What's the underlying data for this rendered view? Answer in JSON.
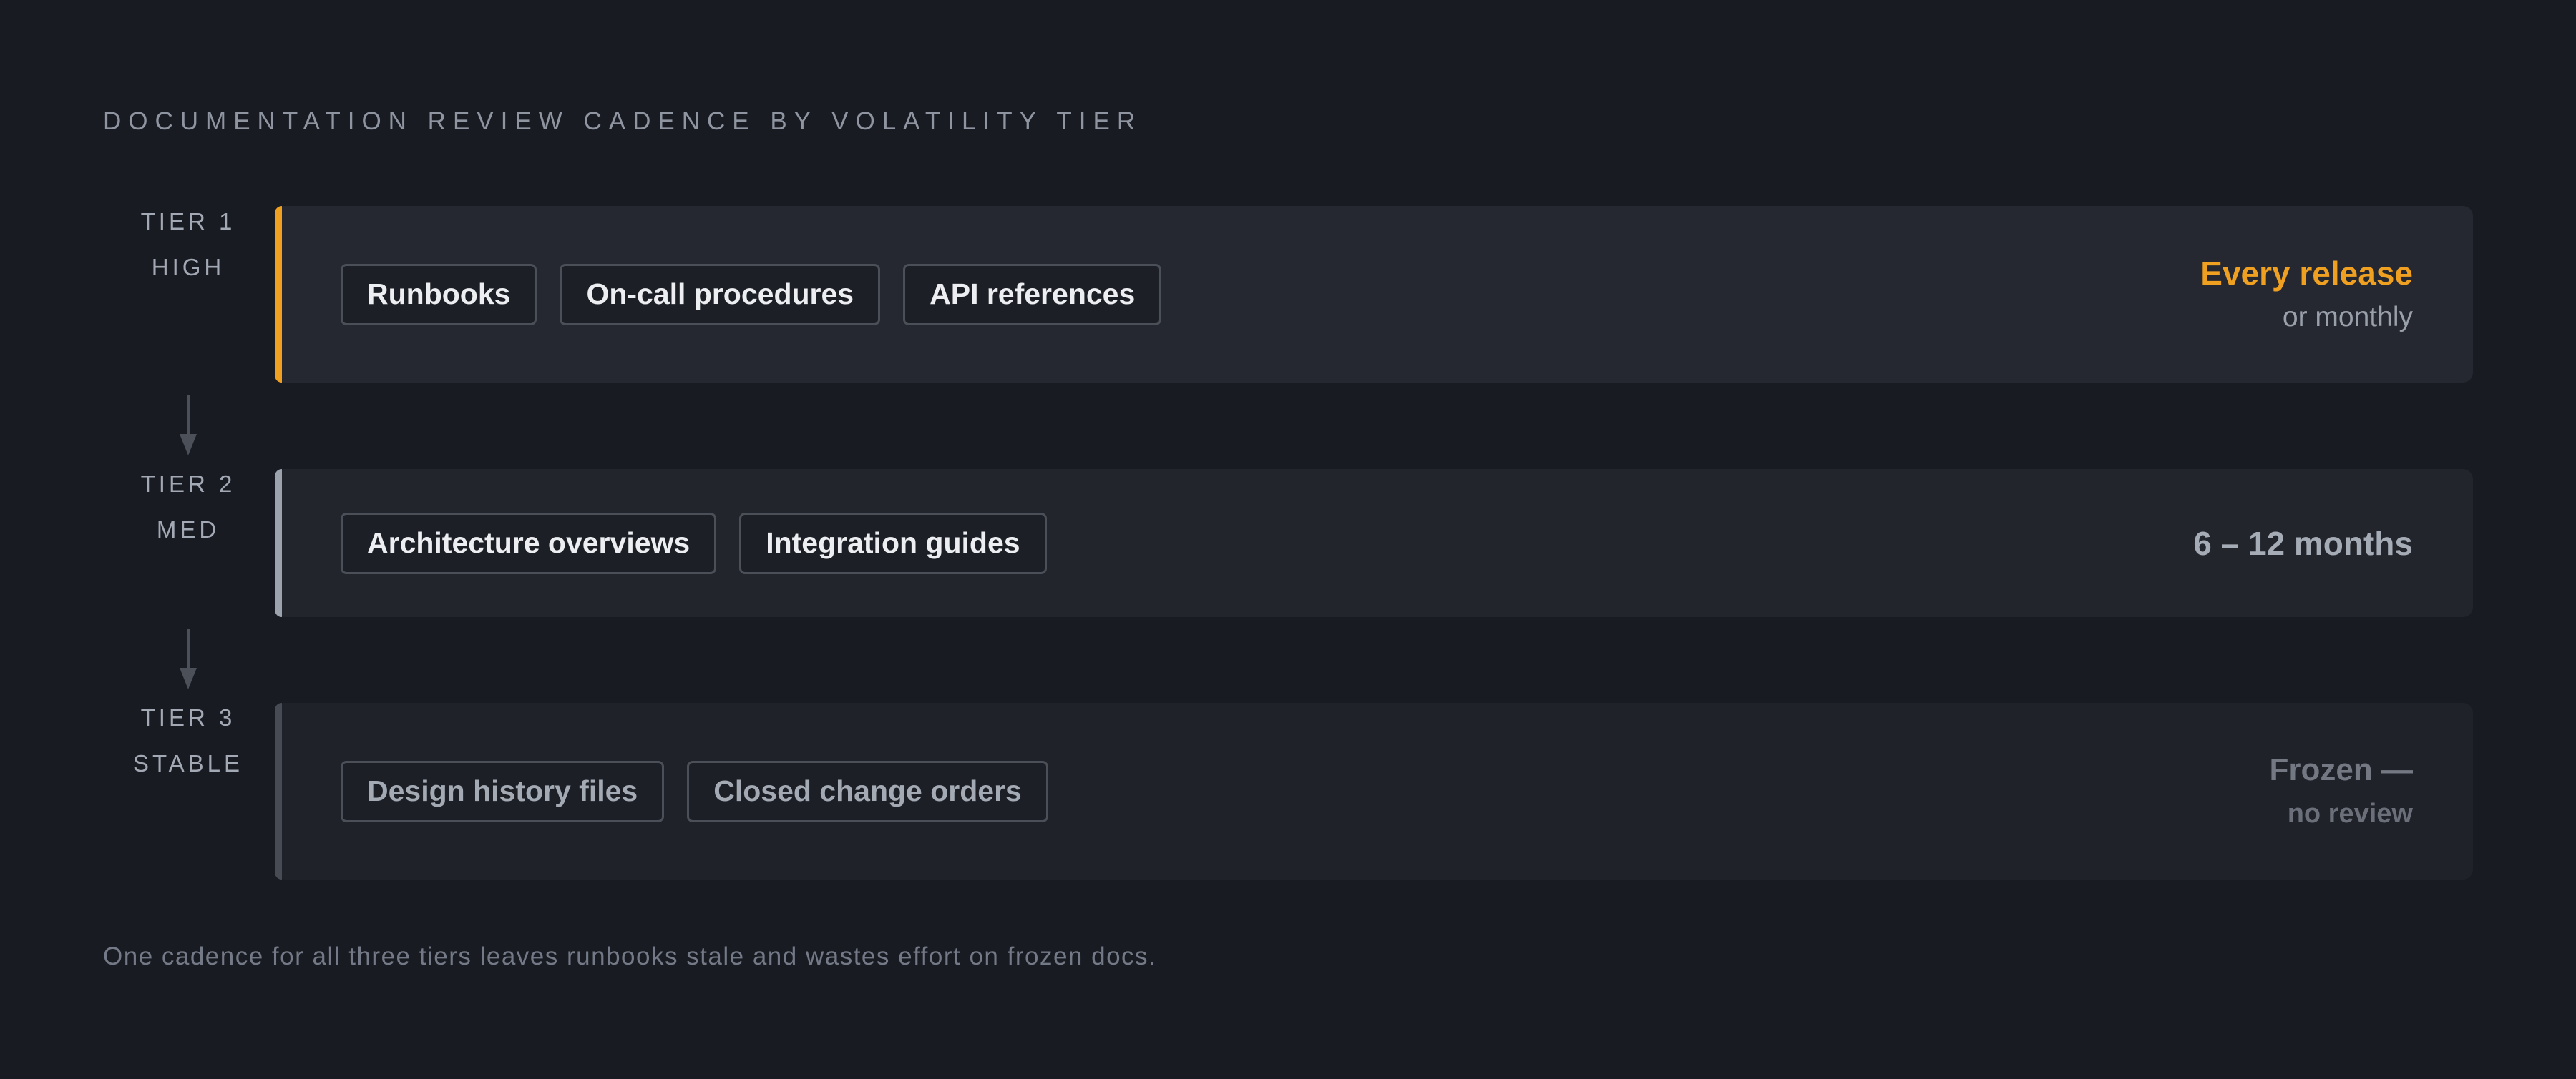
{
  "title": "DOCUMENTATION REVIEW CADENCE BY VOLATILITY TIER",
  "tiers": [
    {
      "tier": "TIER 1",
      "level": "HIGH",
      "items": [
        "Runbooks",
        "On-call procedures",
        "API references"
      ],
      "cadence_main": "Every release",
      "cadence_sub": "or monthly",
      "accent_color": "#f0a020"
    },
    {
      "tier": "TIER 2",
      "level": "MED",
      "items": [
        "Architecture overviews",
        "Integration guides"
      ],
      "cadence_main": "6 – 12 months",
      "cadence_sub": "",
      "accent_color": "#9ca3ad"
    },
    {
      "tier": "TIER 3",
      "level": "STABLE",
      "items": [
        "Design history files",
        "Closed change orders"
      ],
      "cadence_main": "Frozen —",
      "cadence_sub": "no review",
      "accent_color": "#464b54"
    }
  ],
  "footnote": "One cadence for all three tiers leaves runbooks stale and wastes effort on frozen docs."
}
